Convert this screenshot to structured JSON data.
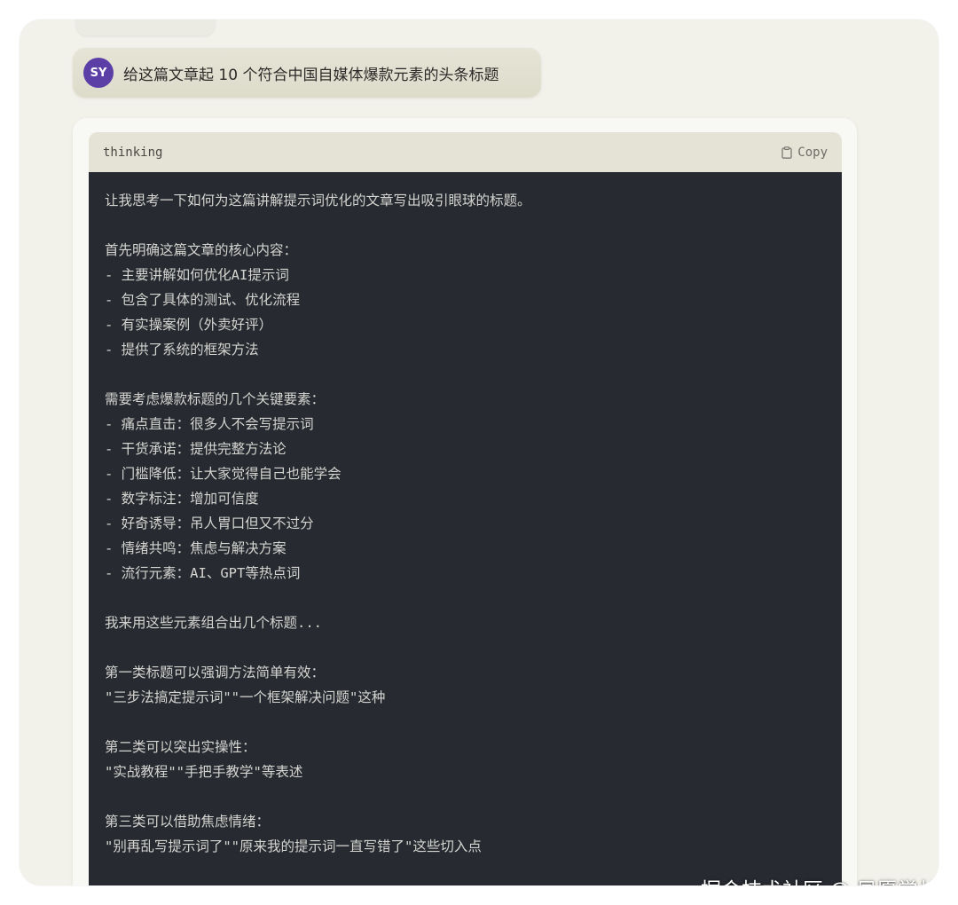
{
  "user_message": {
    "avatar_initials": "SY",
    "avatar_color": "#5b3fa7",
    "text": "给这篇文章起 10 个符合中国自媒体爆款元素的头条标题"
  },
  "code_block": {
    "language": "thinking",
    "copy_label": "Copy",
    "copy_icon": "clipboard-icon",
    "background": "#272a30",
    "lines": [
      "让我思考一下如何为这篇讲解提示词优化的文章写出吸引眼球的标题。",
      "",
      "首先明确这篇文章的核心内容：",
      "- 主要讲解如何优化AI提示词",
      "- 包含了具体的测试、优化流程",
      "- 有实操案例（外卖好评）",
      "- 提供了系统的框架方法",
      "",
      "需要考虑爆款标题的几个关键要素：",
      "- 痛点直击：很多人不会写提示词",
      "- 干货承诺：提供完整方法论",
      "- 门槛降低：让大家觉得自己也能学会",
      "- 数字标注：增加可信度",
      "- 好奇诱导：吊人胃口但又不过分",
      "- 情绪共鸣：焦虑与解决方案",
      "- 流行元素：AI、GPT等热点词",
      "",
      "我来用这些元素组合出几个标题...",
      "",
      "第一类标题可以强调方法简单有效：",
      "\"三步法搞定提示词\"\"一个框架解决问题\"这种",
      "",
      "第二类可以突出实操性：",
      "\"实战教程\"\"手把手教学\"等表述",
      "",
      "第三类可以借助焦虑情绪：",
      "\"别再乱写提示词了\"\"原来我的提示词一直写错了\"这些切入点"
    ]
  },
  "watermark": "掘金技术社区 @ 夙愿学长"
}
